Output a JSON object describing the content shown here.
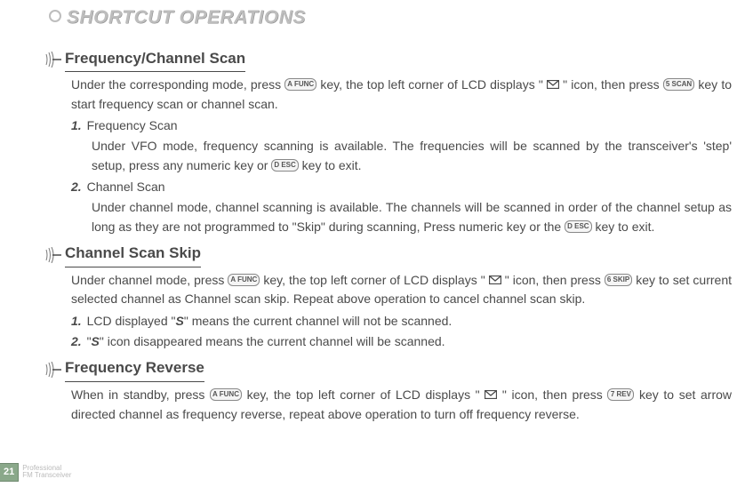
{
  "heading": "SHORTCUT OPERATIONS",
  "sections": {
    "freq_scan": {
      "title": "Frequency/Channel Scan",
      "intro_a": "Under the corresponding mode, press ",
      "intro_b": " key, the top left corner of LCD displays \" ",
      "intro_c": "\" icon, then press ",
      "intro_d": " key to start frequency scan or channel scan.",
      "item1_num": "1.",
      "item1_label": " Frequency Scan",
      "item1_body_a": "Under VFO mode, frequency scanning is available. The frequencies will be scanned by the transceiver's 'step' setup, press any numeric key or ",
      "item1_body_b": " key to exit.",
      "item2_num": "2.",
      "item2_label": " Channel Scan",
      "item2_body_a": "Under channel mode, channel scanning is available. The channels will be scanned in order of the channel setup as long as they are not programmed to \"Skip\" during scanning, Press numeric key or the ",
      "item2_body_b": " key to exit."
    },
    "scan_skip": {
      "title": "Channel Scan Skip",
      "intro_a": "Under channel mode, press ",
      "intro_b": " key, the top left corner of LCD displays \" ",
      "intro_c": " \" icon, then press ",
      "intro_d": " key to set current selected channel as Channel scan skip. Repeat above operation to cancel channel scan skip.",
      "item1_num": "1.",
      "item1_a": " LCD displayed \"",
      "item1_s": "S",
      "item1_b": "\" means the current channel will not be scanned.",
      "item2_num": "2.",
      "item2_a": " \"",
      "item2_s": "S",
      "item2_b": "\" icon disappeared means the current channel will be scanned."
    },
    "freq_rev": {
      "title": "Frequency Reverse",
      "intro_a": "When in standby, press ",
      "intro_b": " key, the top left corner of LCD displays \" ",
      "intro_c": " \" icon, then press ",
      "intro_d": " key to set arrow directed channel as frequency reverse, repeat above operation to turn off frequency reverse."
    }
  },
  "keys": {
    "func": "A FUNC",
    "scan": "5 SCAN",
    "esc": "D ESC",
    "skip": "6 SKIP",
    "rev": "7 REV"
  },
  "footer": {
    "page": "21",
    "line1": "Professional",
    "line2": "FM Transceiver"
  }
}
